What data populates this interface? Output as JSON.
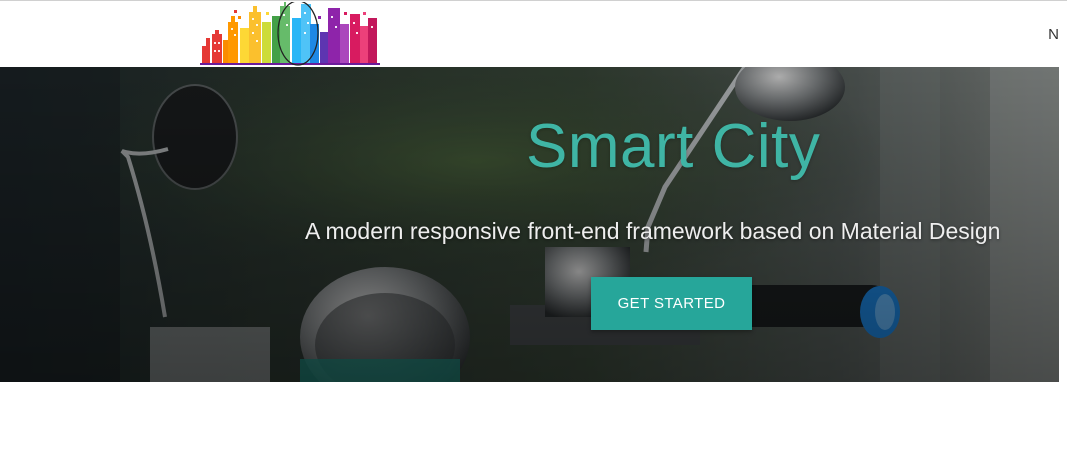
{
  "navbar": {
    "logo_name": "city-skyline-logo",
    "menu_toggle_text": "N"
  },
  "hero": {
    "title": "Smart City",
    "subtitle": "A modern responsive front-end framework based on Material Design",
    "cta_label": "GET STARTED",
    "background": "motorcycle-handlebar-photo"
  },
  "colors": {
    "accent": "#26a69a",
    "title": "#3fb5a5",
    "subtitle": "#eeeeee",
    "page_background": "#ffffff"
  }
}
